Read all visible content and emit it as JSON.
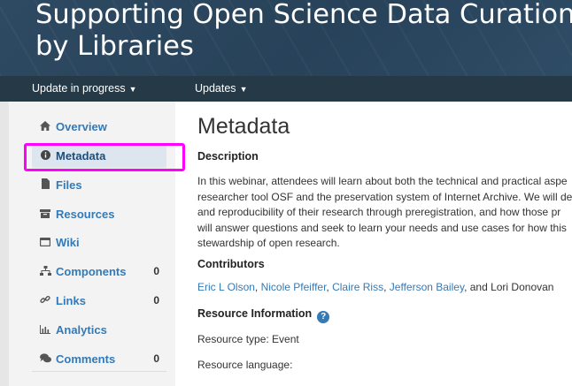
{
  "banner": {
    "title_line1": "Supporting Open Science Data Curation, Pre",
    "title_line2": "by Libraries"
  },
  "nav": {
    "status_label": "Update in progress",
    "updates_label": "Updates"
  },
  "sidebar": {
    "items": [
      {
        "label": "Overview",
        "icon": "home-icon",
        "count": ""
      },
      {
        "label": "Metadata",
        "icon": "info-circle-icon",
        "count": "",
        "active": true
      },
      {
        "label": "Files",
        "icon": "file-icon",
        "count": ""
      },
      {
        "label": "Resources",
        "icon": "archive-icon",
        "count": ""
      },
      {
        "label": "Wiki",
        "icon": "wiki-icon",
        "count": ""
      },
      {
        "label": "Components",
        "icon": "sitemap-icon",
        "count": "0"
      },
      {
        "label": "Links",
        "icon": "link-icon",
        "count": "0"
      },
      {
        "label": "Analytics",
        "icon": "chart-icon",
        "count": ""
      },
      {
        "label": "Comments",
        "icon": "comments-icon",
        "count": "0"
      }
    ]
  },
  "main": {
    "title": "Metadata",
    "description_heading": "Description",
    "description_lines": [
      "In this webinar, attendees will learn about both the technical and practical aspe",
      "researcher tool OSF and the preservation system of Internet Archive. We will de",
      "and reproducibility of their research through preregistration, and how those pr",
      "will answer questions and seek to learn your needs and use cases for how this",
      "stewardship of open research."
    ],
    "contributors_heading": "Contributors",
    "contributors": [
      "Eric L Olson",
      "Nicole Pfeiffer",
      "Claire Riss",
      "Jefferson Bailey"
    ],
    "contributors_tail": ", and Lori Donovan",
    "resource_heading": "Resource Information",
    "resource_type": "Resource type: Event",
    "resource_language": "Resource language:"
  }
}
